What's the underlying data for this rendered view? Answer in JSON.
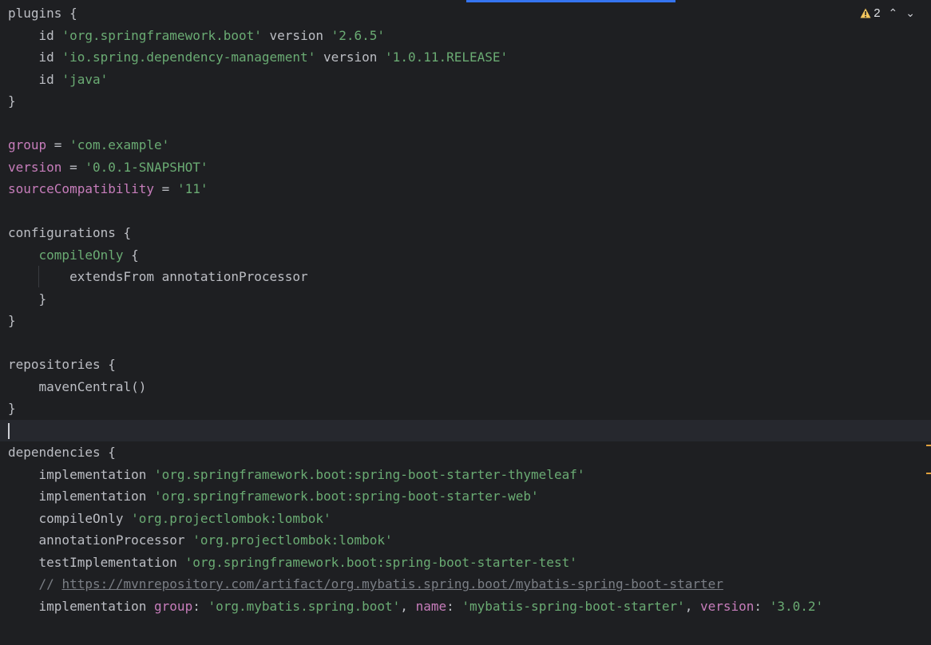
{
  "inspections": {
    "warning_count": "2"
  },
  "code": {
    "plugins_kw": "plugins",
    "id": "id",
    "version_kw": "version",
    "plugin1": "'org.springframework.boot'",
    "plugin1_ver": "'2.6.5'",
    "plugin2": "'io.spring.dependency-management'",
    "plugin2_ver": "'1.0.11.RELEASE'",
    "plugin3": "'java'",
    "group_kw": "group",
    "group_val": "'com.example'",
    "version_prop": "version",
    "version_val": "'0.0.1-SNAPSHOT'",
    "srccompat_kw": "sourceCompatibility",
    "srccompat_val": "'11'",
    "configurations_kw": "configurations",
    "compileOnly_kw": "compileOnly",
    "extends_line": "extendsFrom annotationProcessor",
    "repositories_kw": "repositories",
    "mavencentral": "mavenCentral()",
    "dependencies_kw": "dependencies",
    "implementation": "implementation",
    "compileOnly": "compileOnly",
    "annotationProcessor": "annotationProcessor",
    "testImplementation": "testImplementation",
    "dep1": "'org.springframework.boot:spring-boot-starter-thymeleaf'",
    "dep2": "'org.springframework.boot:spring-boot-starter-web'",
    "dep3": "'org.projectlombok:lombok'",
    "dep4": "'org.projectlombok:lombok'",
    "dep5": "'org.springframework.boot:spring-boot-starter-test'",
    "comment_prefix": "// ",
    "comment_url": "https://mvnrepository.com/artifact/org.mybatis.spring.boot/mybatis-spring-boot-starter",
    "group_named": "group",
    "name_named": "name",
    "version_named": "version",
    "mybatis_group": "'org.mybatis.spring.boot'",
    "mybatis_name": "'mybatis-spring-boot-starter'",
    "mybatis_version": "'3.0.2'"
  }
}
